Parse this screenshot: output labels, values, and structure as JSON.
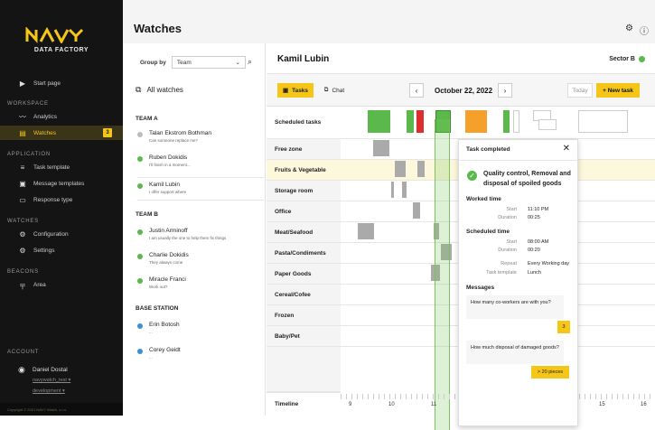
{
  "sidebar": {
    "logo_sub": "DATA FACTORY",
    "start_page": "Start page",
    "sections": {
      "workspace": "WORKSPACE",
      "application": "APPLICATION",
      "watches": "WATCHES",
      "beacons": "BEACONS",
      "account": "ACCOUNT"
    },
    "workspace_items": [
      "Analytics",
      "Watches"
    ],
    "watches_badge": "3",
    "application_items": [
      "Task template",
      "Message templates",
      "Response type"
    ],
    "watches_items": [
      "Configuration",
      "Settings"
    ],
    "beacons_items": [
      "Area"
    ],
    "account_name": "Daniel Dostal",
    "account_user": "navywatch_test",
    "account_env": "development",
    "copyright": "Copyright © 2021 NAVY Watch, s.r.o."
  },
  "page_title": "Watches",
  "left": {
    "group_by_label": "Group by",
    "group_by_value": "Team",
    "all_watches": "All watches",
    "team_a": "TEAM A",
    "team_b": "TEAM B",
    "base_station": "BASE STATION",
    "people": [
      {
        "name": "Talan Ekstrom Bothman",
        "status": "Can someone replace me?"
      },
      {
        "name": "Ruben Dokidis",
        "status": "I'll finish in a moment..."
      },
      {
        "name": "Kamil Lubin",
        "status": "I offer support where"
      },
      {
        "name": "Justin Arminoff",
        "status": "I am usually the one to help them fix things"
      },
      {
        "name": "Charlie Dokidis",
        "status": "They always come"
      },
      {
        "name": "Miracle Franci",
        "status": "Work out?"
      },
      {
        "name": "Erin Botosh",
        "status": "..."
      },
      {
        "name": "Corey Geidt",
        "status": "..."
      }
    ]
  },
  "header": {
    "person": "Kamil Lubin",
    "sector": "Sector B"
  },
  "toolbar": {
    "tasks": "Tasks",
    "chat": "Chat",
    "date": "October 22, 2022",
    "today": "Today",
    "new_task": "+ New task",
    "prev": "‹",
    "next": "›"
  },
  "rows": [
    "Scheduled tasks",
    "Free zone",
    "Fruits & Vegetable",
    "Storage room",
    "Office",
    "Meat/Seafood",
    "Pasta/Condiments",
    "Paper Goods",
    "Cereal/Cofee",
    "Frozen",
    "Baby/Pet"
  ],
  "timeline": {
    "label": "Timeline",
    "ticks": [
      "9",
      "10",
      "11",
      "12",
      "13",
      "14",
      "15",
      "16"
    ]
  },
  "popup": {
    "header": "Task completed",
    "title": "Quality control, Removal and disposal of spoiled goods",
    "worked_time": "Worked time",
    "start_k": "Start",
    "start_v": "11:10 PM",
    "duration_k": "Duration",
    "duration_v": "00:25",
    "scheduled_time": "Scheduled time",
    "s_start_v": "08:00 AM",
    "s_duration_v": "00:20",
    "repeat_k": "Repeat",
    "repeat_v": "Every Working day",
    "template_k": "Task template",
    "template_v": "Lunch",
    "messages": "Messages",
    "msg1": "How many co-workers are with you?",
    "msg1_reply": "3",
    "msg2": "How much disposal of damaged goods?",
    "msg2_reply": "> 20 pieces"
  },
  "colors": {
    "accent": "#f5c518",
    "green": "#5bb94b",
    "red": "#e02c2c",
    "orange": "#f5a02a"
  }
}
